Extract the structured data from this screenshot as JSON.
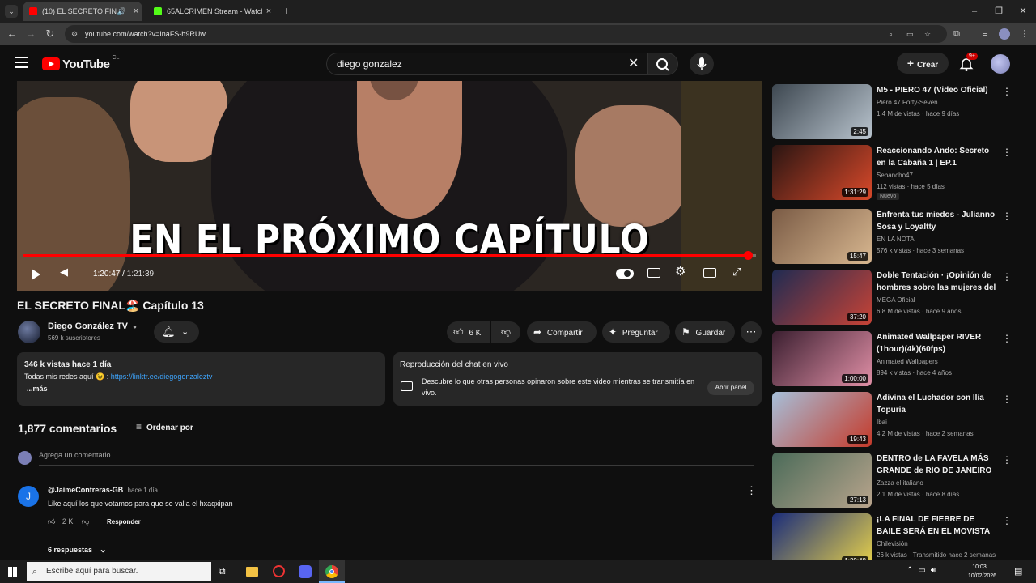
{
  "browser": {
    "tabs": [
      {
        "title": "(10) EL SECRETO FINAL🏖️ C",
        "active": true,
        "color": "#ff0000"
      },
      {
        "title": "65ALCRIMEN Stream - Watch L",
        "active": false,
        "color": "#53fc18"
      }
    ],
    "url": "youtube.com/watch?v=InaFS-h9RUw"
  },
  "youtube": {
    "logo": "YouTube",
    "region": "CL",
    "search_value": "diego gonzalez",
    "create_label": "Crear",
    "notif_count": "9+"
  },
  "video": {
    "overlay_text": "EN EL PRÓXIMO CAPÍTULO",
    "time_current": "1:20:47",
    "time_total": "1:21:39",
    "progress": 0.9895,
    "title": "EL SECRETO FINAL🏖️ Capítulo 13"
  },
  "channel": {
    "name": "Diego González TV",
    "subs": "569 k suscriptores"
  },
  "actions": {
    "likes": "6 K",
    "share": "Compartir",
    "ask": "Preguntar",
    "save": "Guardar"
  },
  "description": {
    "meta": "346 k vistas  hace 1 día",
    "line1": "Todas mis redes aquí 😉 : ",
    "link": "https://linktr.ee/diegogonzaleztv",
    "more": "...más"
  },
  "chat": {
    "title": "Reproducción del chat en vivo",
    "text": "Descubre lo que otras personas opinaron sobre este video mientras se transmitía en vivo.",
    "button": "Abrir panel"
  },
  "comments": {
    "count_label": "1,877 comentarios",
    "sort_label": "Ordenar por",
    "placeholder": "Agrega un comentario...",
    "first": {
      "avatar_letter": "J",
      "author": "@JaimeContreras-GB",
      "time": "hace 1 día",
      "text": "Like aquí los que votamos para que se valla el hxaqxipan",
      "likes": "2 K",
      "reply": "Responder",
      "replies": "6 respuestas"
    }
  },
  "related": [
    {
      "title": "M5 - PIERO 47 (Video Oficial)",
      "channel": "Piero 47 Forty-Seven",
      "meta": "1.4 M de vistas · hace 9 días",
      "duration": "2:45",
      "badge": ""
    },
    {
      "title": "Reaccionando Ando: Secreto en la Cabaña 1 | EP.1",
      "channel": "Sebancho47",
      "meta": "112 vistas · hace 5 días",
      "duration": "1:31:29",
      "badge": "Nuevo"
    },
    {
      "title": "Enfrenta tus miedos - Julianno Sosa y Loyaltty",
      "channel": "EN LA NOTA",
      "meta": "576 k vistas · hace 3 semanas",
      "duration": "15:47",
      "badge": ""
    },
    {
      "title": "Doble Tentación · ¡Opinión de hombres sobre las mujeres del ...",
      "channel": "MEGA Oficial",
      "meta": "6.8 M de vistas · hace 9 años",
      "duration": "37:20",
      "badge": ""
    },
    {
      "title": "Animated Wallpaper RIVER (1hour)(4k)(60fps)",
      "channel": "Animated Wallpapers",
      "meta": "894 k vistas · hace 4 años",
      "duration": "1:00:00",
      "badge": ""
    },
    {
      "title": "Adivina el Luchador con Ilia Topuria",
      "channel": "Ibai",
      "meta": "4.2 M de vistas · hace 2 semanas",
      "duration": "19:43",
      "badge": ""
    },
    {
      "title": "DENTRO de LA FAVELA MÁS GRANDE de RÍO DE JANEIRO (...",
      "channel": "Zazza el italiano",
      "meta": "2.1 M de vistas · hace 8 días",
      "duration": "27:13",
      "badge": ""
    },
    {
      "title": "¡LA FINAL DE FIEBRE DE BAILE SERÁ EN EL MOVISTA ARENA!...",
      "channel": "Chilevisión",
      "meta": "26 k vistas · Transmitido hace 2 semanas",
      "duration": "1:39:48",
      "badge": ""
    }
  ],
  "taskbar": {
    "search_placeholder": "Escribe aquí para buscar.",
    "time": "10:03",
    "date": "10/02/2026"
  }
}
